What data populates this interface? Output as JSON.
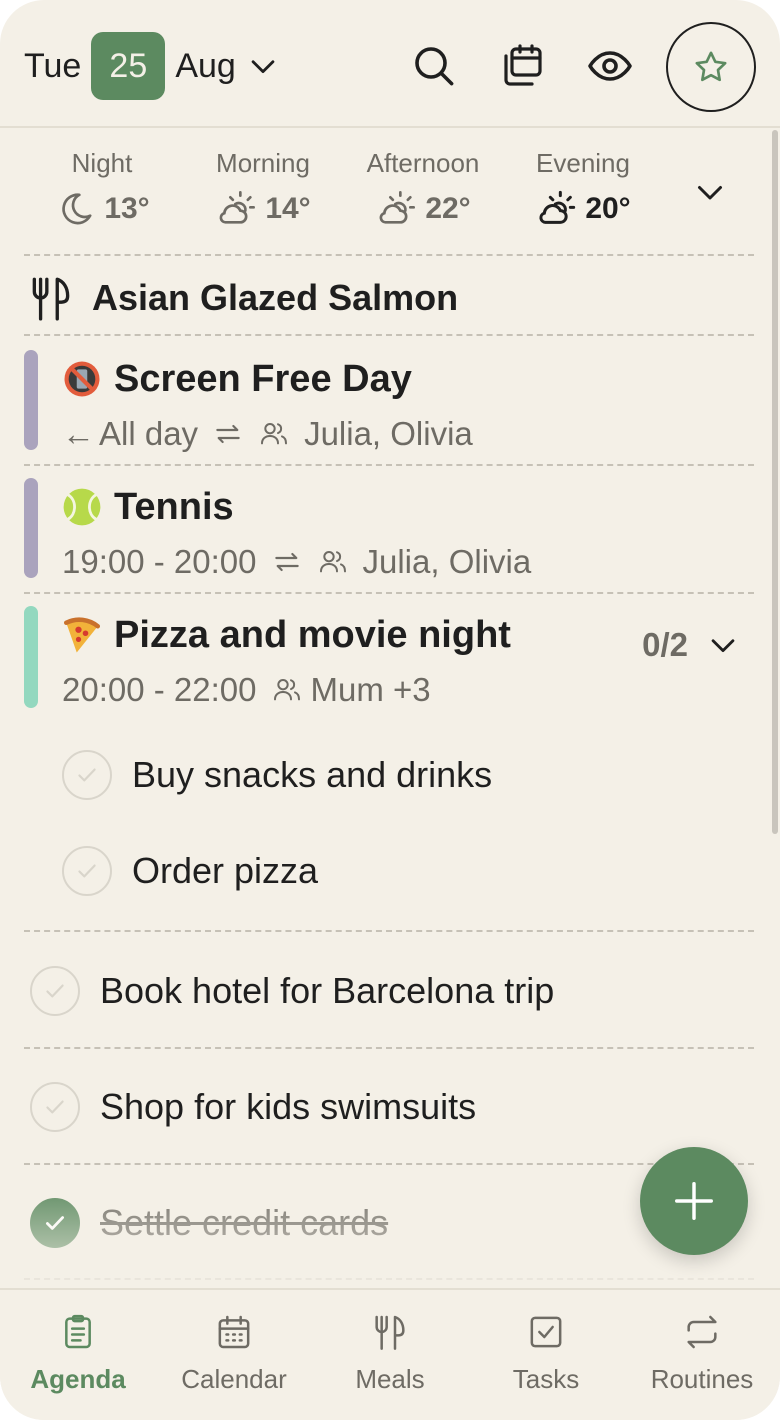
{
  "colors": {
    "background": "#f4f0e7",
    "accent": "#5c8a60",
    "event_purple": "#aaa3bd",
    "event_mint": "#93d8bf",
    "muted_text": "#6e6b64"
  },
  "header": {
    "day_of_week": "Tue",
    "day": "25",
    "month": "Aug",
    "icons": [
      "search-icon",
      "calendar-switch-icon",
      "eye-icon",
      "star-icon"
    ]
  },
  "weather": [
    {
      "label": "Night",
      "temp": "13°",
      "icon": "moon-icon"
    },
    {
      "label": "Morning",
      "temp": "14°",
      "icon": "partly-sunny-icon"
    },
    {
      "label": "Afternoon",
      "temp": "22°",
      "icon": "partly-sunny-icon"
    },
    {
      "label": "Evening",
      "temp": "20°",
      "icon": "partly-sunny-icon"
    }
  ],
  "meal": {
    "title": "Asian Glazed Salmon",
    "icon": "fork-knife-icon"
  },
  "events": [
    {
      "emoji": "no-phone-icon",
      "title": "Screen Free Day",
      "time": "All day",
      "people": "Julia, Olivia",
      "recurring": true
    },
    {
      "emoji": "tennis-ball-icon",
      "title": "Tennis",
      "time": "19:00 - 20:00",
      "people": "Julia, Olivia",
      "recurring": true
    },
    {
      "emoji": "pizza-icon",
      "title": "Pizza and movie night",
      "time": "20:00 - 22:00",
      "people": "Mum +3",
      "progress": "0/2",
      "subtasks": [
        {
          "label": "Buy snacks and drinks",
          "done": false
        },
        {
          "label": "Order pizza",
          "done": false
        }
      ]
    }
  ],
  "tasks": [
    {
      "label": "Book hotel for Barcelona trip",
      "done": false
    },
    {
      "label": "Shop for kids swimsuits",
      "done": false
    },
    {
      "label": "Settle credit cards",
      "done": true
    }
  ],
  "nav": [
    {
      "label": "Agenda",
      "icon": "clipboard-icon",
      "active": true
    },
    {
      "label": "Calendar",
      "icon": "calendar-icon",
      "active": false
    },
    {
      "label": "Meals",
      "icon": "fork-knife-icon",
      "active": false
    },
    {
      "label": "Tasks",
      "icon": "checkbox-icon",
      "active": false
    },
    {
      "label": "Routines",
      "icon": "repeat-icon",
      "active": false
    }
  ]
}
